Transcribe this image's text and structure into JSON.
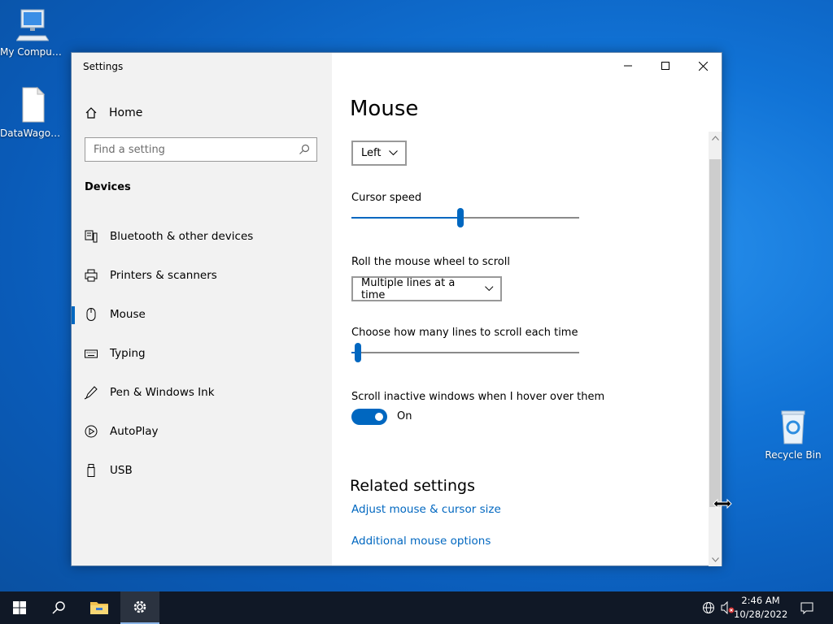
{
  "desktop": {
    "icons": [
      {
        "label": "My Computer"
      },
      {
        "label": "DataWagon..."
      },
      {
        "label": "Recycle Bin"
      }
    ]
  },
  "window": {
    "title": "Settings",
    "controls": {
      "minimize": "minimize-icon",
      "maximize": "maximize-icon",
      "close": "close-icon"
    }
  },
  "sidebar": {
    "home": "Home",
    "search_placeholder": "Find a setting",
    "section": "Devices",
    "items": [
      {
        "label": "Bluetooth & other devices",
        "icon": "bluetooth-devices-icon"
      },
      {
        "label": "Printers & scanners",
        "icon": "printer-icon"
      },
      {
        "label": "Mouse",
        "icon": "mouse-icon",
        "active": true
      },
      {
        "label": "Typing",
        "icon": "keyboard-icon"
      },
      {
        "label": "Pen & Windows Ink",
        "icon": "pen-icon"
      },
      {
        "label": "AutoPlay",
        "icon": "autoplay-icon"
      },
      {
        "label": "USB",
        "icon": "usb-icon"
      }
    ]
  },
  "main": {
    "title": "Mouse",
    "primary_button": {
      "value": "Left"
    },
    "cursor_speed": {
      "label": "Cursor speed",
      "value_fraction": 0.48
    },
    "scroll_mode": {
      "label": "Roll the mouse wheel to scroll",
      "value": "Multiple lines at a time"
    },
    "scroll_lines": {
      "label": "Choose how many lines to scroll each time",
      "value_fraction": 0.03
    },
    "inactive_scroll": {
      "label": "Scroll inactive windows when I hover over them",
      "state": "On"
    },
    "related": {
      "title": "Related settings",
      "links": [
        "Adjust mouse & cursor size",
        "Additional mouse options"
      ]
    }
  },
  "taskbar": {
    "time": "2:46 AM",
    "date": "10/28/2022"
  },
  "colors": {
    "accent": "#0067c0",
    "taskbar": "#101826",
    "sidebar": "#f2f2f2"
  }
}
